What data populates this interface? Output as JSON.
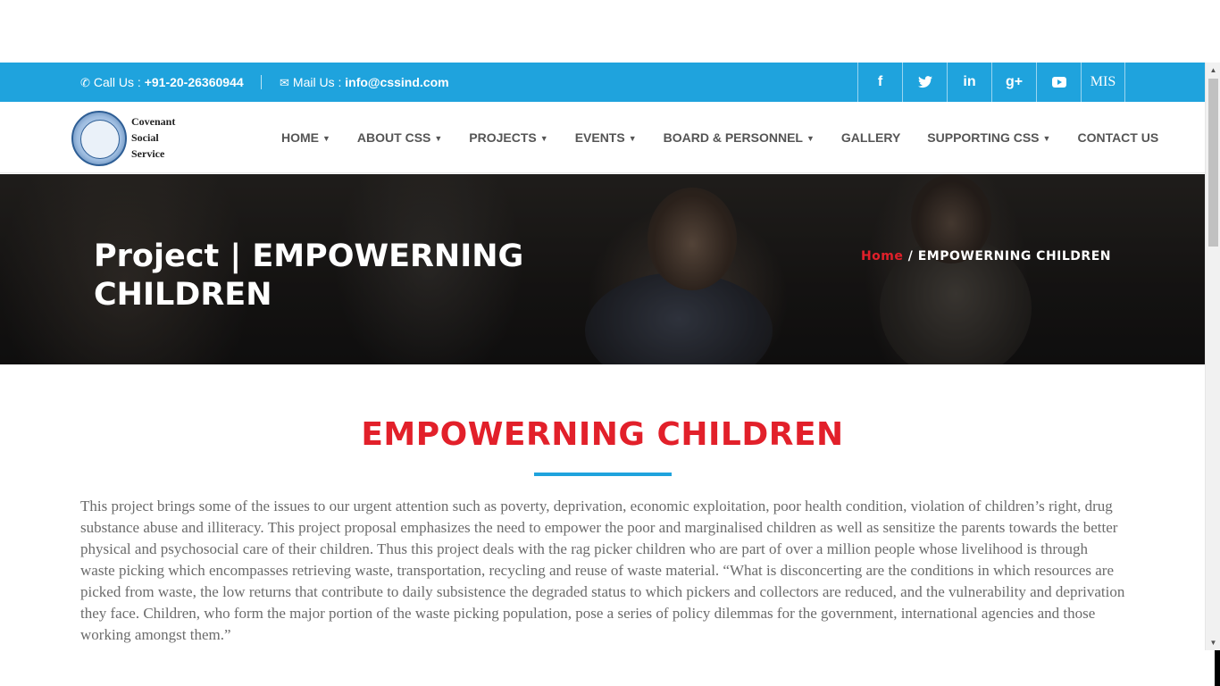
{
  "topbar": {
    "call_label": "Call Us : ",
    "call_number": "+91-20-26360944",
    "mail_label": "Mail Us : ",
    "mail_address": "info@cssind.com",
    "social": [
      {
        "name": "facebook",
        "glyph": "f"
      },
      {
        "name": "twitter",
        "glyph": "t"
      },
      {
        "name": "linkedin",
        "glyph": "in"
      },
      {
        "name": "google-plus",
        "glyph": "g+"
      },
      {
        "name": "youtube",
        "glyph": ""
      },
      {
        "name": "mis",
        "glyph": "MIS"
      }
    ],
    "color": "#1fa3dd"
  },
  "logo": {
    "line1": "Covenant",
    "line2": "Social",
    "line3": "Service"
  },
  "nav": {
    "items": [
      {
        "label": "HOME",
        "dropdown": true
      },
      {
        "label": "ABOUT CSS",
        "dropdown": true
      },
      {
        "label": "PROJECTS",
        "dropdown": true
      },
      {
        "label": "EVENTS",
        "dropdown": true
      },
      {
        "label": "BOARD & PERSONNEL",
        "dropdown": true
      },
      {
        "label": "GALLERY",
        "dropdown": false
      },
      {
        "label": "SUPPORTING CSS",
        "dropdown": true
      },
      {
        "label": "CONTACT US",
        "dropdown": false
      }
    ]
  },
  "hero": {
    "title": "Project | EMPOWERNING CHILDREN",
    "breadcrumb_home": "Home",
    "breadcrumb_sep": " / ",
    "breadcrumb_current": "EMPOWERNING CHILDREN"
  },
  "content": {
    "heading": "EMPOWERNING CHILDREN",
    "accent_color": "#e2202a",
    "paragraph": "This project brings some of the issues to our urgent attention such as poverty, deprivation, economic exploitation, poor health condition, violation of children’s right, drug substance abuse and illiteracy. This project proposal emphasizes the need to empower the poor and marginalised children as well as sensitize the parents towards the better physical and psychosocial care of their children. Thus this project deals with the rag picker children who are part of over a million people whose livelihood is through waste picking which encompasses retrieving waste, transportation, recycling and reuse of waste material. “What is disconcerting are the conditions in which resources are picked from waste, the low returns that contribute to daily subsistence the degraded status to which pickers and collectors are reduced, and the vulnerability and deprivation they face. Children, who form the major portion of the waste picking population, pose a series of policy dilemmas for the government, international agencies and those working amongst them.”"
  }
}
